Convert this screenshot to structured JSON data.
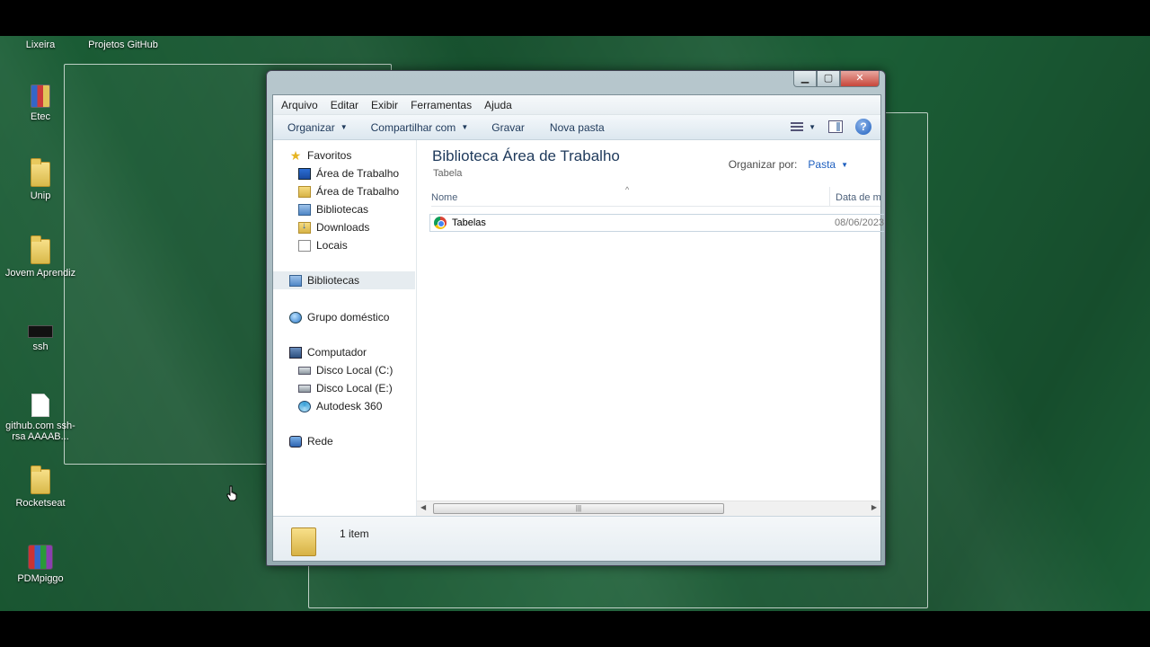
{
  "desktop": {
    "top_labels": [
      "Lixeira",
      "Projetos GitHub"
    ],
    "icons": [
      {
        "label": "Etec",
        "icon": "multicolor-folder-icon"
      },
      {
        "label": "Unip",
        "icon": "folder-icon"
      },
      {
        "label": "Jovem Aprendiz",
        "icon": "folder-icon"
      },
      {
        "label": "ssh",
        "icon": "terminal-icon"
      },
      {
        "label": "github.com ssh-rsa AAAAB...",
        "icon": "document-icon"
      },
      {
        "label": "Rocketseat",
        "icon": "folder-icon"
      },
      {
        "label": "PDMpiggo",
        "icon": "winrar-icon"
      }
    ]
  },
  "window": {
    "caption": {
      "min": "▁",
      "max": "▢",
      "close": "✕"
    },
    "menu": [
      "Arquivo",
      "Editar",
      "Exibir",
      "Ferramentas",
      "Ajuda"
    ],
    "toolbar": {
      "organize": "Organizar",
      "share": "Compartilhar com",
      "burn": "Gravar",
      "new_folder": "Nova pasta",
      "help": "?"
    },
    "nav": {
      "favorites": "Favoritos",
      "fav_items": [
        "Área de Trabalho",
        "Área de Trabalho",
        "Bibliotecas",
        "Downloads",
        "Locais"
      ],
      "libraries": "Bibliotecas",
      "homegroup": "Grupo doméstico",
      "computer": "Computador",
      "computer_items": [
        "Disco Local (C:)",
        "Disco Local (E:)",
        "Autodesk 360"
      ],
      "network": "Rede"
    },
    "content": {
      "title": "Biblioteca Área de Trabalho",
      "subtitle": "Tabela",
      "arrange_label": "Organizar por:",
      "arrange_value": "Pasta",
      "col_name": "Nome",
      "col_date": "Data de m",
      "rows": [
        {
          "name": "Tabelas",
          "date": "08/06/2023"
        }
      ]
    },
    "details": {
      "count": "1 item"
    }
  }
}
